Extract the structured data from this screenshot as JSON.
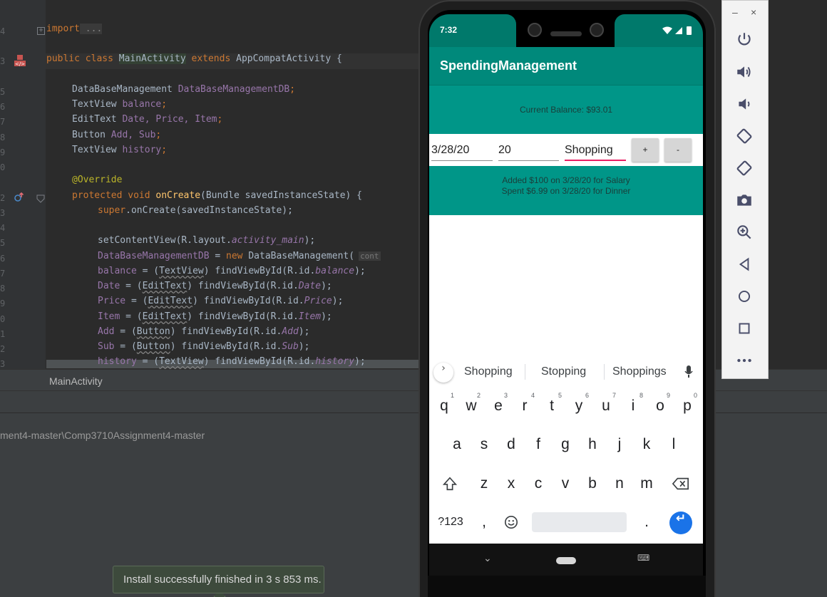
{
  "editor": {
    "gutter_numbers": [
      "4",
      "3",
      "5",
      "6",
      "7",
      "8",
      "9",
      "0",
      "2",
      "3",
      "4",
      "5",
      "6",
      "7",
      "8",
      "9",
      "0",
      "1",
      "2",
      "3"
    ],
    "lines": {
      "l1": {
        "kw": "import",
        "rest": " ..."
      },
      "l2": {
        "kw1": "public class",
        "name": "MainActivity",
        "kw2": "extends",
        "rest": "AppCompatActivity {"
      },
      "l3": {
        "type": "DataBaseManagement",
        "field": "DataBaseManagementDB",
        "end": ";"
      },
      "l4": {
        "type": "TextView",
        "field": "balance",
        "end": ";"
      },
      "l5": {
        "type": "EditText",
        "field": "Date, Price, Item",
        "end": ";"
      },
      "l6": {
        "type": "Button",
        "field": "Add, Sub",
        "end": ";"
      },
      "l7": {
        "type": "TextView",
        "field": "history",
        "end": ";"
      },
      "l8": {
        "ann": "@Override"
      },
      "l9": {
        "kw": "protected void",
        "fn": "onCreate",
        "rest": "(Bundle savedInstanceState) {"
      },
      "l10": {
        "kw": "super",
        "rest": ".onCreate(savedInstanceState);"
      },
      "l11": {
        "pre": "setContentView(R.layout.",
        "it": "activity_main",
        "post": ");"
      },
      "l12": {
        "field": "DataBaseManagementDB",
        "eq": " = ",
        "kw": "new",
        "rest": " DataBaseManagement(",
        "hint": "cont"
      },
      "l13": {
        "field": "balance",
        "pre": " = (",
        "cast": "TextView",
        "mid": ") findViewById(R.id.",
        "it": "balance",
        "post": ");"
      },
      "l14": {
        "field": "Date",
        "pre": " = (",
        "cast": "EditText",
        "mid": ") findViewById(R.id.",
        "it": "Date",
        "post": ");"
      },
      "l15": {
        "field": "Price",
        "pre": " = (",
        "cast": "EditText",
        "mid": ") findViewById(R.id.",
        "it": "Price",
        "post": ");"
      },
      "l16": {
        "field": "Item",
        "pre": " = (",
        "cast": "EditText",
        "mid": ") findViewById(R.id.",
        "it": "Item",
        "post": ");"
      },
      "l17": {
        "field": "Add",
        "pre": " = (",
        "cast": "Button",
        "mid": ") findViewById(R.id.",
        "it": "Add",
        "post": ");"
      },
      "l18": {
        "field": "Sub",
        "pre": " = (",
        "cast": "Button",
        "mid": ") findViewById(R.id.",
        "it": "Sub",
        "post": ");"
      },
      "l19": {
        "field": "history",
        "pre": " = (",
        "cast": "TextView",
        "mid": ") findViewById(R.id.",
        "it": "history",
        "post": ");"
      }
    },
    "tab_label": "MainActivity",
    "project_path": "ment4-master\\Comp3710Assignment4-master",
    "toast": "Install successfully finished in 3 s 853 ms."
  },
  "emulator_toolbar": {
    "minimize": "–",
    "close": "×",
    "icons": [
      "power-icon",
      "volume-up-icon",
      "volume-down-icon",
      "rotate-left-icon",
      "rotate-right-icon",
      "camera-icon",
      "zoom-icon",
      "back-icon",
      "home-icon",
      "overview-icon",
      "more-icon"
    ]
  },
  "phone": {
    "time": "7:32",
    "app_title": "SpendingManagement",
    "balance": "Current Balance: $93.01",
    "date_value": "3/28/20",
    "price_value": "20",
    "item_value": "Shopping",
    "add_label": "+",
    "sub_label": "-",
    "history": [
      "Added $100 on 3/28/20 for Salary",
      "Spent $6.99 on 3/28/20 for Dinner"
    ],
    "accent_color": "#009688",
    "suggestions": [
      "Shopping",
      "Stopping",
      "Shoppings"
    ],
    "keyboard": {
      "row1": [
        "q",
        "w",
        "e",
        "r",
        "t",
        "y",
        "u",
        "i",
        "o",
        "p"
      ],
      "row1_hints": [
        "1",
        "2",
        "3",
        "4",
        "5",
        "6",
        "7",
        "8",
        "9",
        "0"
      ],
      "row2": [
        "a",
        "s",
        "d",
        "f",
        "g",
        "h",
        "j",
        "k",
        "l"
      ],
      "row3": [
        "z",
        "x",
        "c",
        "v",
        "b",
        "n",
        "m"
      ],
      "symbols": "?123",
      "comma": ",",
      "period": "."
    }
  }
}
